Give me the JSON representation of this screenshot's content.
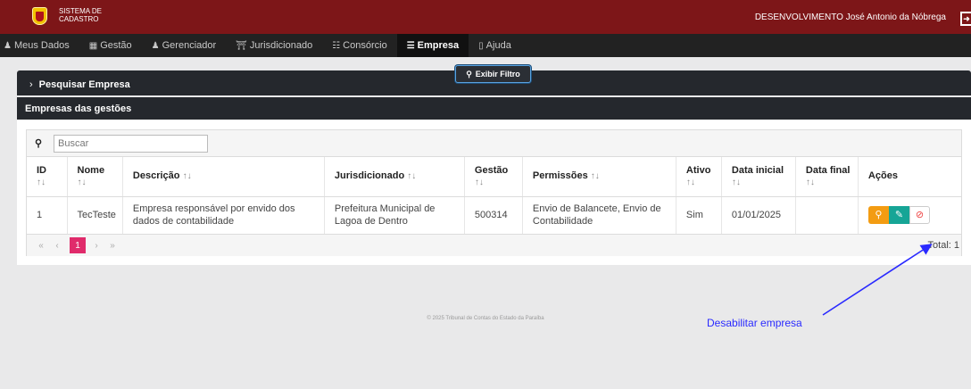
{
  "header": {
    "system_line1": "SISTEMA DE",
    "system_line2": "CADASTRO",
    "user_info": "DESENVOLVIMENTO José Antonio da Nóbrega"
  },
  "menu": [
    {
      "label": "Meus Dados",
      "icon": "user-icon"
    },
    {
      "label": "Gestão",
      "icon": "calendar-icon"
    },
    {
      "label": "Gerenciador",
      "icon": "user-icon"
    },
    {
      "label": "Jurisdicionado",
      "icon": "bank-icon"
    },
    {
      "label": "Consórcio",
      "icon": "sitemap-icon"
    },
    {
      "label": "Empresa",
      "icon": "list-icon"
    },
    {
      "label": "Ajuda",
      "icon": "book-icon"
    }
  ],
  "filter": {
    "panel_title": "Pesquisar Empresa",
    "toggle_label": "Exibir Filtro"
  },
  "list": {
    "panel_title": "Empresas das gestões",
    "search_placeholder": "Buscar",
    "columns": [
      "ID",
      "Nome",
      "Descrição",
      "Jurisdicionado",
      "Gestão",
      "Permissões",
      "Ativo",
      "Data inicial",
      "Data final",
      "Ações"
    ],
    "rows": [
      {
        "id": "1",
        "nome": "TecTeste",
        "descricao": "Empresa responsável por envido dos dados de contabilidade",
        "jurisdicionado": "Prefeitura Municipal de Lagoa de Dentro",
        "gestao": "500314",
        "permissoes": "Envio de Balancete, Envio de Contabilidade",
        "ativo": "Sim",
        "data_inicial": "01/01/2025",
        "data_final": ""
      }
    ],
    "pagination": {
      "first": "«",
      "prev": "‹",
      "current": "1",
      "next": "›",
      "last": "»",
      "total": "Total: 1"
    }
  },
  "footer": "© 2025 Tribunal de Contas do Estado da Paraíba",
  "annotation": "Desabilitar empresa",
  "colors": {
    "topbar": "#7d1618",
    "menubar": "#222222",
    "panel_header": "#25282d",
    "view_button": "#f39c12",
    "edit_button": "#16a596",
    "pager_active": "#e02b6b",
    "annotation": "#2a2aff"
  }
}
